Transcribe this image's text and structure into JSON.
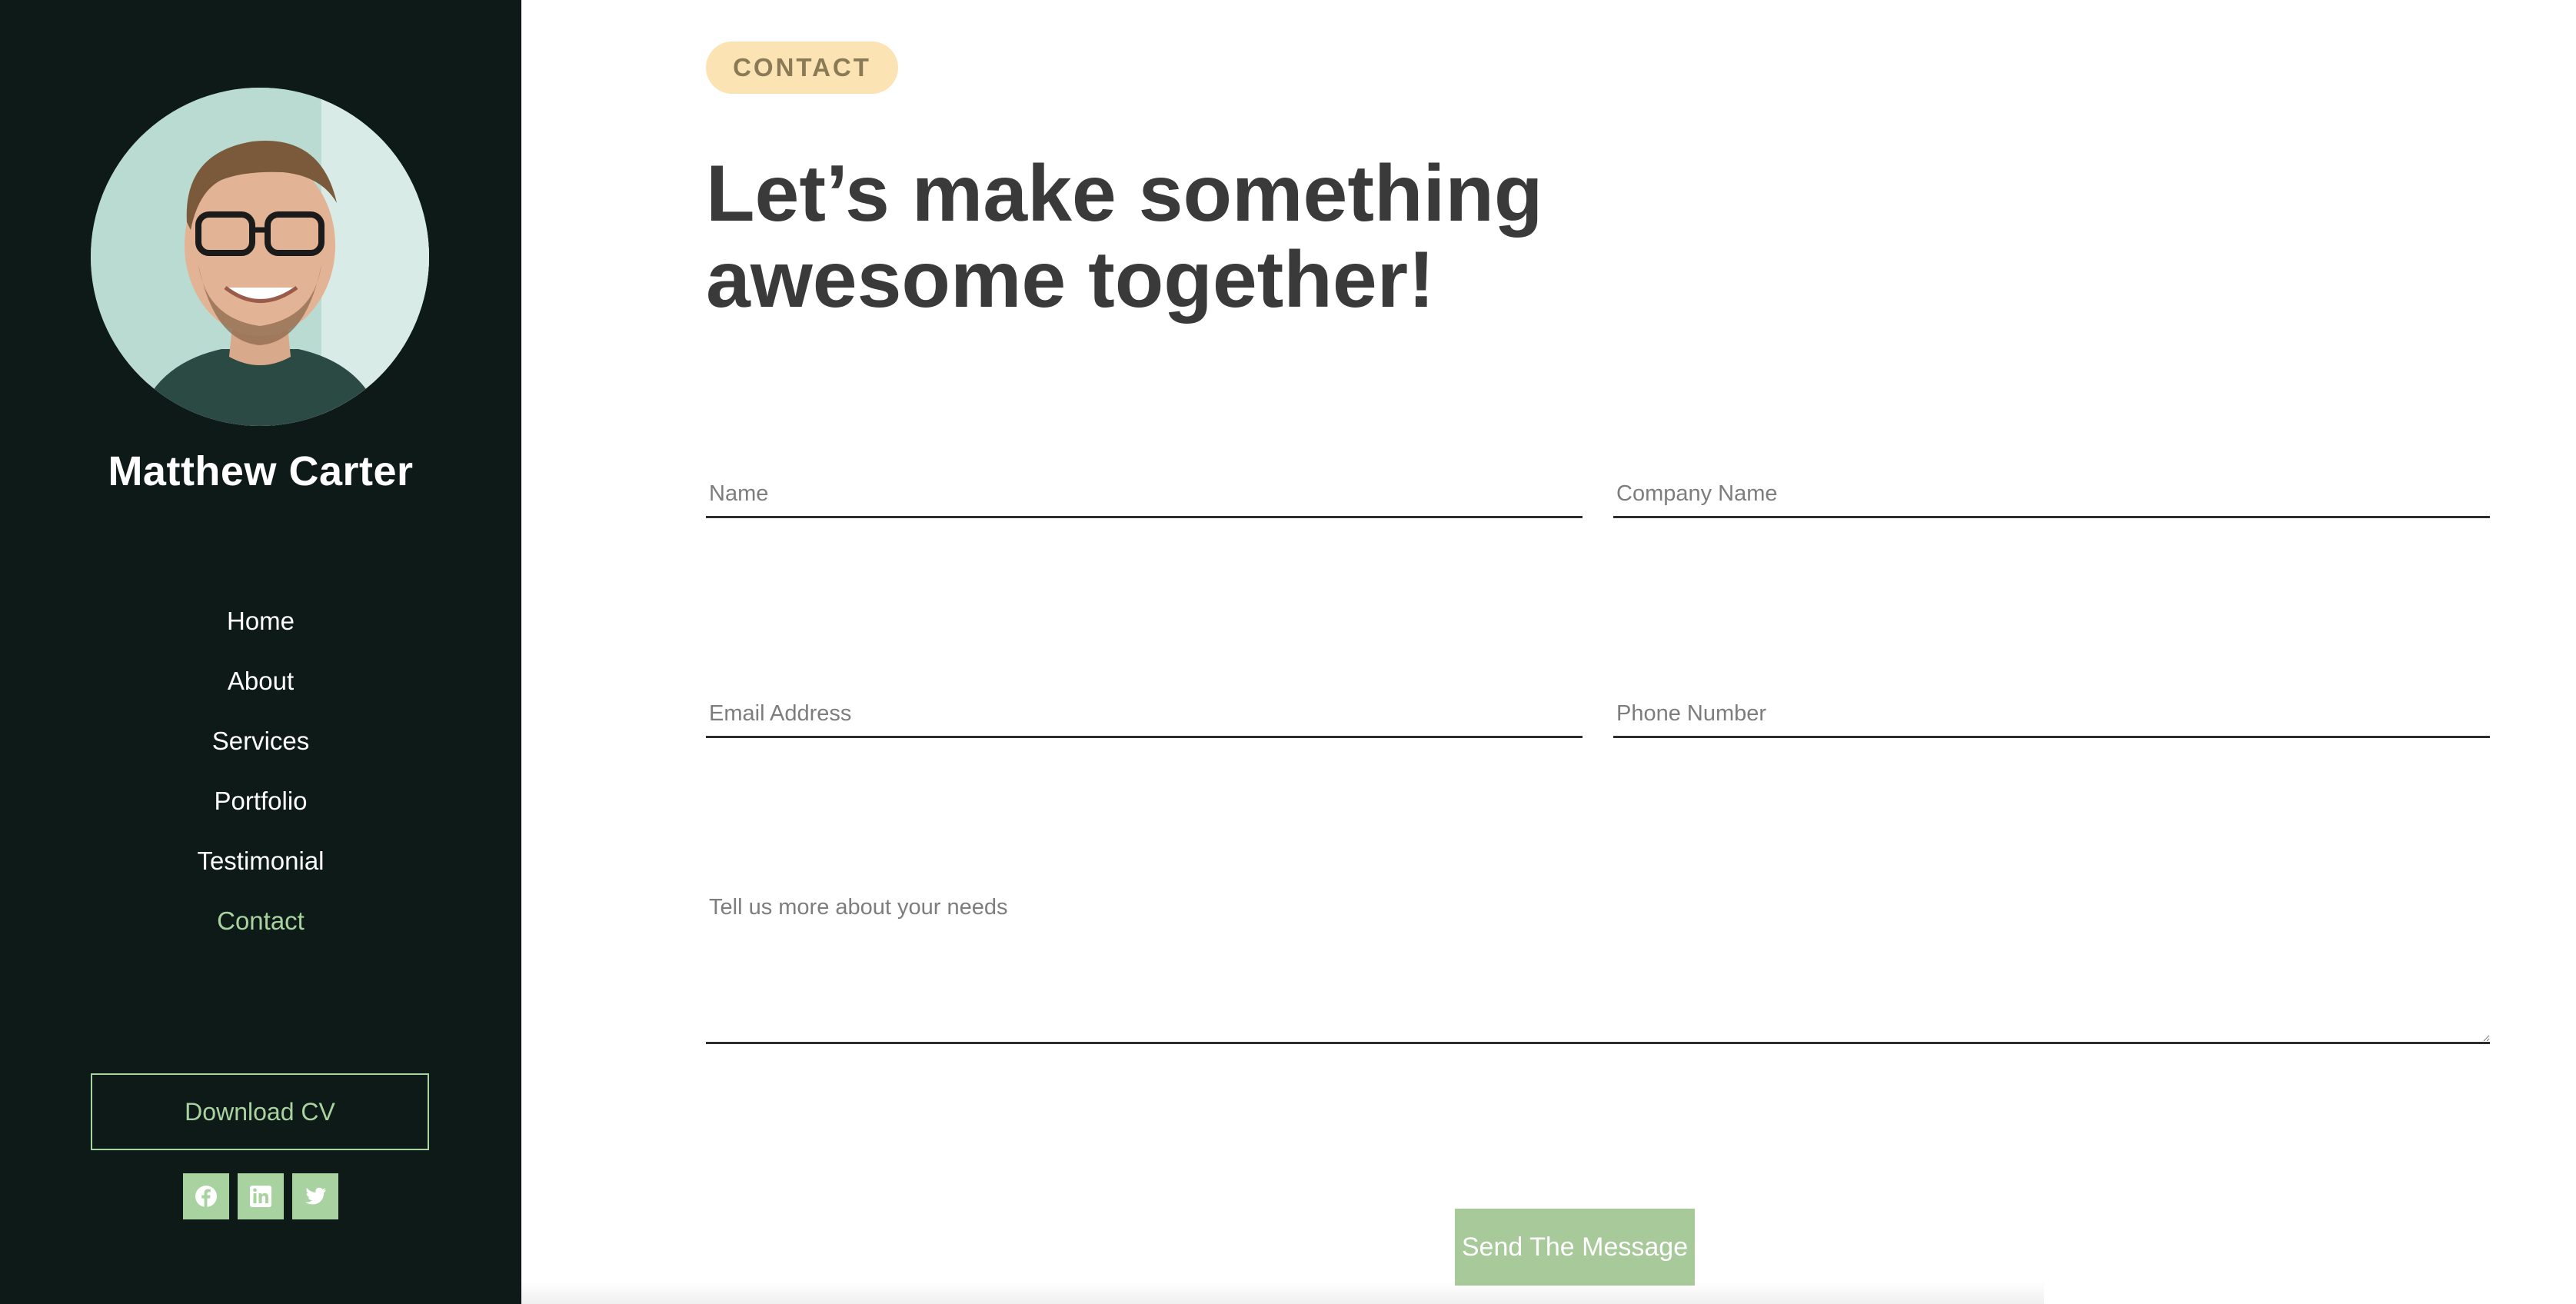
{
  "sidebar": {
    "profile_name": "Matthew Carter",
    "nav_items": [
      {
        "label": "Home"
      },
      {
        "label": "About"
      },
      {
        "label": "Services"
      },
      {
        "label": "Portfolio"
      },
      {
        "label": "Testimonial"
      },
      {
        "label": "Contact",
        "active": true
      }
    ],
    "download_cv_label": "Download CV",
    "social_icons": [
      "facebook-icon",
      "linkedin-icon",
      "twitter-icon"
    ]
  },
  "main": {
    "section_badge": "CONTACT",
    "headline_line1": "Let’s make something",
    "headline_line2": "awesome together!",
    "form": {
      "name_placeholder": "Name",
      "company_placeholder": "Company Name",
      "email_placeholder": "Email Address",
      "phone_placeholder": "Phone Number",
      "message_placeholder": "Tell us more about your needs",
      "submit_label": "Send The Message"
    }
  },
  "colors": {
    "sidebar_bg": "#0e1a17",
    "accent_green": "#a8d3a0",
    "button_green": "#a8c99a",
    "badge_bg": "#fbe3b4",
    "headline_text": "#3a3a3a"
  }
}
